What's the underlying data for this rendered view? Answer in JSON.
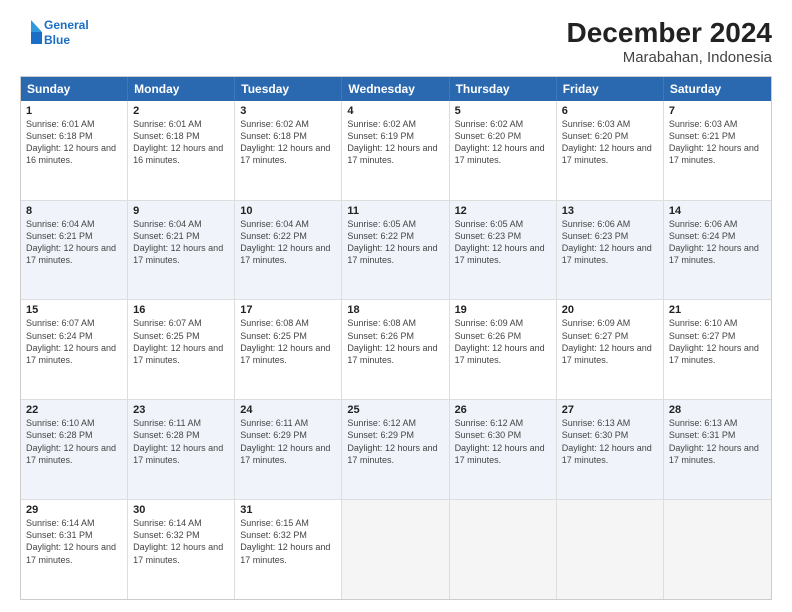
{
  "header": {
    "logo_line1": "General",
    "logo_line2": "Blue",
    "title": "December 2024",
    "subtitle": "Marabahan, Indonesia"
  },
  "calendar": {
    "days_of_week": [
      "Sunday",
      "Monday",
      "Tuesday",
      "Wednesday",
      "Thursday",
      "Friday",
      "Saturday"
    ],
    "rows": [
      [
        {
          "day": "1",
          "sunrise": "6:01 AM",
          "sunset": "6:18 PM",
          "daylight": "12 hours and 16 minutes."
        },
        {
          "day": "2",
          "sunrise": "6:01 AM",
          "sunset": "6:18 PM",
          "daylight": "12 hours and 16 minutes."
        },
        {
          "day": "3",
          "sunrise": "6:02 AM",
          "sunset": "6:18 PM",
          "daylight": "12 hours and 17 minutes."
        },
        {
          "day": "4",
          "sunrise": "6:02 AM",
          "sunset": "6:19 PM",
          "daylight": "12 hours and 17 minutes."
        },
        {
          "day": "5",
          "sunrise": "6:02 AM",
          "sunset": "6:20 PM",
          "daylight": "12 hours and 17 minutes."
        },
        {
          "day": "6",
          "sunrise": "6:03 AM",
          "sunset": "6:20 PM",
          "daylight": "12 hours and 17 minutes."
        },
        {
          "day": "7",
          "sunrise": "6:03 AM",
          "sunset": "6:21 PM",
          "daylight": "12 hours and 17 minutes."
        }
      ],
      [
        {
          "day": "8",
          "sunrise": "6:04 AM",
          "sunset": "6:21 PM",
          "daylight": "12 hours and 17 minutes."
        },
        {
          "day": "9",
          "sunrise": "6:04 AM",
          "sunset": "6:21 PM",
          "daylight": "12 hours and 17 minutes."
        },
        {
          "day": "10",
          "sunrise": "6:04 AM",
          "sunset": "6:22 PM",
          "daylight": "12 hours and 17 minutes."
        },
        {
          "day": "11",
          "sunrise": "6:05 AM",
          "sunset": "6:22 PM",
          "daylight": "12 hours and 17 minutes."
        },
        {
          "day": "12",
          "sunrise": "6:05 AM",
          "sunset": "6:23 PM",
          "daylight": "12 hours and 17 minutes."
        },
        {
          "day": "13",
          "sunrise": "6:06 AM",
          "sunset": "6:23 PM",
          "daylight": "12 hours and 17 minutes."
        },
        {
          "day": "14",
          "sunrise": "6:06 AM",
          "sunset": "6:24 PM",
          "daylight": "12 hours and 17 minutes."
        }
      ],
      [
        {
          "day": "15",
          "sunrise": "6:07 AM",
          "sunset": "6:24 PM",
          "daylight": "12 hours and 17 minutes."
        },
        {
          "day": "16",
          "sunrise": "6:07 AM",
          "sunset": "6:25 PM",
          "daylight": "12 hours and 17 minutes."
        },
        {
          "day": "17",
          "sunrise": "6:08 AM",
          "sunset": "6:25 PM",
          "daylight": "12 hours and 17 minutes."
        },
        {
          "day": "18",
          "sunrise": "6:08 AM",
          "sunset": "6:26 PM",
          "daylight": "12 hours and 17 minutes."
        },
        {
          "day": "19",
          "sunrise": "6:09 AM",
          "sunset": "6:26 PM",
          "daylight": "12 hours and 17 minutes."
        },
        {
          "day": "20",
          "sunrise": "6:09 AM",
          "sunset": "6:27 PM",
          "daylight": "12 hours and 17 minutes."
        },
        {
          "day": "21",
          "sunrise": "6:10 AM",
          "sunset": "6:27 PM",
          "daylight": "12 hours and 17 minutes."
        }
      ],
      [
        {
          "day": "22",
          "sunrise": "6:10 AM",
          "sunset": "6:28 PM",
          "daylight": "12 hours and 17 minutes."
        },
        {
          "day": "23",
          "sunrise": "6:11 AM",
          "sunset": "6:28 PM",
          "daylight": "12 hours and 17 minutes."
        },
        {
          "day": "24",
          "sunrise": "6:11 AM",
          "sunset": "6:29 PM",
          "daylight": "12 hours and 17 minutes."
        },
        {
          "day": "25",
          "sunrise": "6:12 AM",
          "sunset": "6:29 PM",
          "daylight": "12 hours and 17 minutes."
        },
        {
          "day": "26",
          "sunrise": "6:12 AM",
          "sunset": "6:30 PM",
          "daylight": "12 hours and 17 minutes."
        },
        {
          "day": "27",
          "sunrise": "6:13 AM",
          "sunset": "6:30 PM",
          "daylight": "12 hours and 17 minutes."
        },
        {
          "day": "28",
          "sunrise": "6:13 AM",
          "sunset": "6:31 PM",
          "daylight": "12 hours and 17 minutes."
        }
      ],
      [
        {
          "day": "29",
          "sunrise": "6:14 AM",
          "sunset": "6:31 PM",
          "daylight": "12 hours and 17 minutes."
        },
        {
          "day": "30",
          "sunrise": "6:14 AM",
          "sunset": "6:32 PM",
          "daylight": "12 hours and 17 minutes."
        },
        {
          "day": "31",
          "sunrise": "6:15 AM",
          "sunset": "6:32 PM",
          "daylight": "12 hours and 17 minutes."
        },
        null,
        null,
        null,
        null
      ]
    ]
  }
}
